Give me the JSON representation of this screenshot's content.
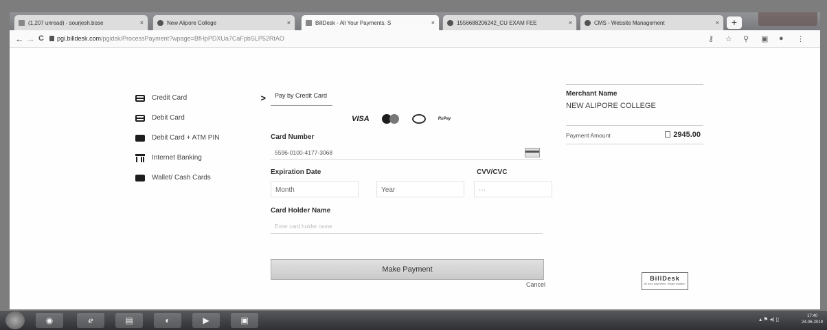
{
  "browser": {
    "tabs": [
      {
        "title": "(1,207 unread) - sourjesh.bose",
        "active": false
      },
      {
        "title": "New Alipore College",
        "active": false
      },
      {
        "title": "BillDesk - All Your Payments. S",
        "active": true
      },
      {
        "title": "1556688206242_CU EXAM FEE",
        "active": false
      },
      {
        "title": "CMS - Website Management",
        "active": false
      }
    ],
    "tab_close": "×",
    "new_tab": "+",
    "url_host": "pgi.billdesk.com",
    "url_path": "/pgidsk/ProcessPayment?wpage=BfHpPDXUa7CaFpbSLP52RtAO",
    "nav": {
      "back": "←",
      "forward": "→",
      "reload": "C"
    }
  },
  "sidebar": {
    "items": [
      {
        "label": "Credit Card",
        "icon": "credit-card-icon",
        "active": true
      },
      {
        "label": "Debit Card",
        "icon": "debit-card-icon",
        "active": false
      },
      {
        "label": "Debit Card + ATM PIN",
        "icon": "pin-icon",
        "active": false
      },
      {
        "label": "Internet Banking",
        "icon": "bank-icon",
        "active": false
      },
      {
        "label": "Wallet/ Cash Cards",
        "icon": "wallet-icon",
        "active": false
      }
    ],
    "active_chevron": ">"
  },
  "form": {
    "tab_label": "Pay by Credit Card",
    "logos": {
      "visa": "VISA",
      "rupay": "RuPay"
    },
    "card_number_label": "Card Number",
    "card_number_value": "5596-0100-4177-3068",
    "expiration_label": "Expiration Date",
    "cvv_label": "CVV/CVC",
    "month_value": "Month",
    "year_value": "Year",
    "cvv_value": "···",
    "holder_label": "Card Holder Name",
    "holder_placeholder": "Enter card holder name",
    "pay_button": "Make Payment",
    "cancel": "Cancel"
  },
  "merchant": {
    "title": "Merchant Name",
    "name": "NEW ALIPORE COLLEGE",
    "amount_label": "Payment Amount",
    "amount_value": "2945.00"
  },
  "branding": {
    "name": "BillDesk",
    "tagline": "All your payments. Single location."
  },
  "taskbar": {
    "apps": [
      "chrome-icon",
      "ie-icon",
      "folder-icon",
      "media-icon",
      "player-icon",
      "window-icon"
    ],
    "clock_time": "17:40",
    "clock_date": "24-06-2019"
  }
}
